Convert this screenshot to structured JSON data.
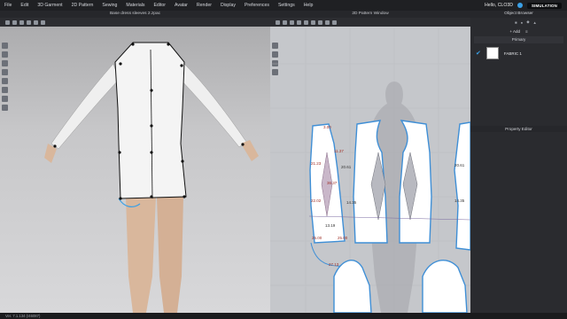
{
  "menu": [
    "File",
    "Edit",
    "3D Garment",
    "2D Pattern",
    "Sewing",
    "Materials",
    "Editor",
    "Avatar",
    "Render",
    "Display",
    "Preferences",
    "Settings",
    "Help"
  ],
  "user": "Hello, CLO3D",
  "mode_button": "SIMULATION",
  "window_3d_title": "Base dress sleeves 2.zpac",
  "window_2d_title": "2D Pattern Window",
  "object_browser": {
    "title": "Object Browser",
    "add_label": "+ Add",
    "primary_label": "Primary",
    "fabric_name": "FABRIC 1",
    "fabric_color": "#ffffff"
  },
  "property_editor_title": "Property Editor",
  "status_text": "Ver. 7.1.134 (r46087)",
  "pattern_labels": {
    "left": [
      "3.00",
      "11.37",
      "21.23",
      "36.37",
      "22.02",
      "25.00",
      "25.00",
      "27.13"
    ],
    "center": [
      "20.61",
      "14.35",
      "13.19"
    ],
    "right": [
      "20.61",
      "14.35"
    ]
  },
  "colors": {
    "accent": "#3aa0e6",
    "pattern_outline": "#3f8fd6",
    "garment": "#f4f4f4"
  }
}
